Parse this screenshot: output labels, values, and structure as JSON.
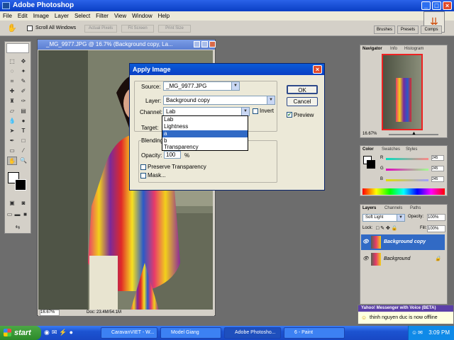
{
  "app": {
    "title": "Adobe Photoshop"
  },
  "menu": [
    "File",
    "Edit",
    "Image",
    "Layer",
    "Select",
    "Filter",
    "View",
    "Window",
    "Help"
  ],
  "options_bar": {
    "scroll_all_windows": "Scroll All Windows",
    "actual_pixels": "Actual Pixels",
    "fit_screen": "Fit Screen",
    "print_size": "Print Size"
  },
  "palette_well": {
    "brushes": "Brushes",
    "presets": "Presets",
    "comps": "Comps"
  },
  "document": {
    "title": "_MG_9977.JPG @ 16.7% (Background copy, La...",
    "zoom": "16.67%",
    "doc_size": "Doc: 23.4M/54.1M"
  },
  "dialog": {
    "title": "Apply Image",
    "source_label": "Source:",
    "source_value": "_MG_9977.JPG",
    "layer_label": "Layer:",
    "layer_value": "Background copy",
    "channel_label": "Channel:",
    "channel_value": "Lab",
    "invert_label": "Invert",
    "target_label": "Target:",
    "blending_label": "Blending",
    "opacity_label": "Opacity:",
    "opacity_value": "100",
    "opacity_unit": "%",
    "preserve_transparency": "Preserve Transparency",
    "mask": "Mask...",
    "ok": "OK",
    "cancel": "Cancel",
    "preview": "Preview",
    "channel_options": [
      "Lab",
      "Lightness",
      "a",
      "b",
      "Transparency"
    ],
    "selected_option": "a"
  },
  "navigator": {
    "tabs": [
      "Navigator",
      "Info",
      "Histogram"
    ],
    "zoom": "16.67%"
  },
  "color": {
    "tabs": [
      "Color",
      "Swatches",
      "Styles"
    ],
    "r_label": "R",
    "g_label": "G",
    "b_label": "B",
    "r_value": "245",
    "g_value": "245",
    "b_value": "245"
  },
  "layers": {
    "tabs": [
      "Layers",
      "Channels",
      "Paths"
    ],
    "blend_mode": "Soft Light",
    "opacity_label": "Opacity:",
    "opacity_value": "100%",
    "lock_label": "Lock:",
    "fill_label": "Fill:",
    "fill_value": "100%",
    "items": [
      "Background copy",
      "Background"
    ]
  },
  "notification": {
    "title": "Yahoo! Messenger with Voice (BETA)",
    "message": "thinh nguyen duc is now offline"
  },
  "taskbar": {
    "start": "start",
    "items": [
      "CaravanVIET - W...",
      "Model Giang",
      "Adobe Photosho...",
      "6 - Paint"
    ],
    "clock": "3:09 PM"
  },
  "colors": {
    "accent": "#0a3fc4",
    "selection": "#316ac5",
    "taskbar": "#1c53d1"
  }
}
